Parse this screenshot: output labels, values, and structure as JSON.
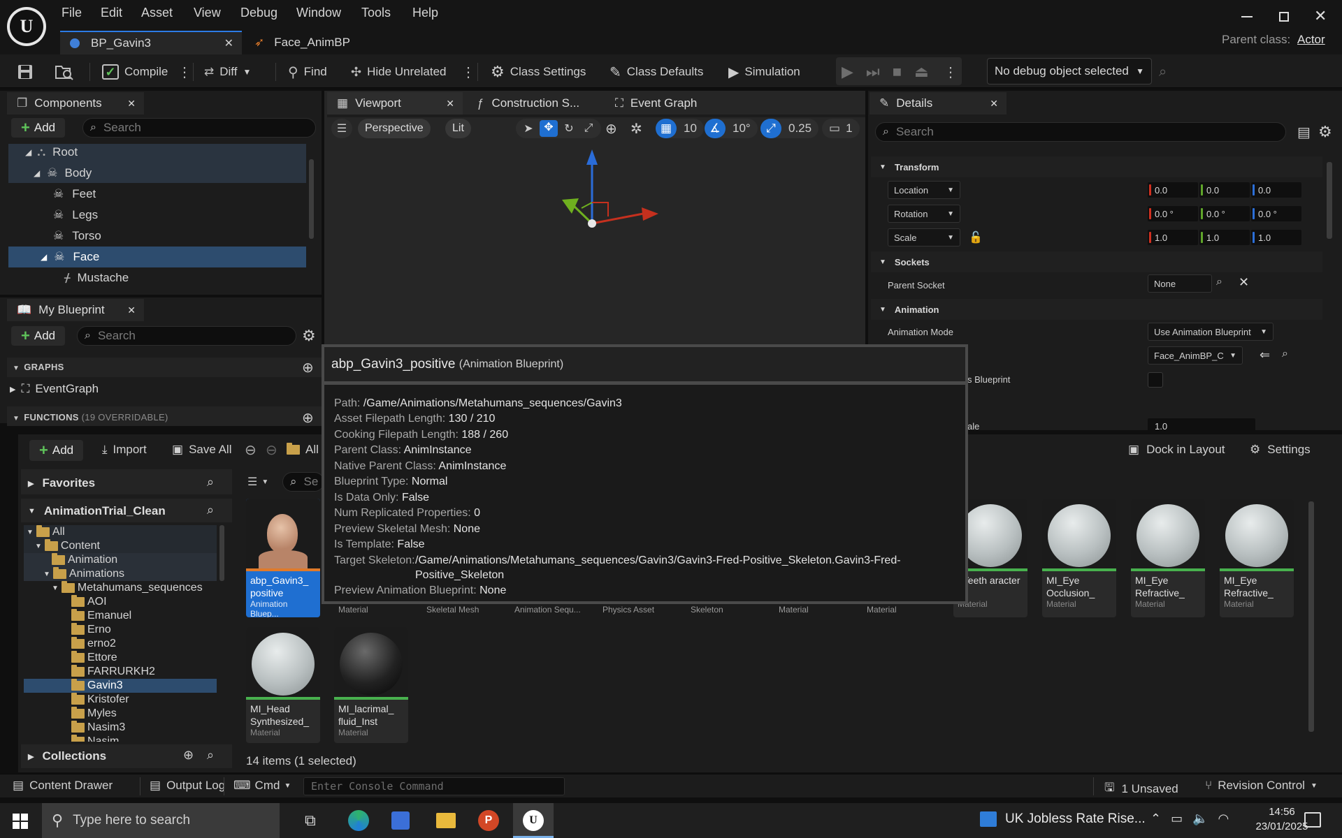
{
  "menu": [
    "File",
    "Edit",
    "Asset",
    "View",
    "Debug",
    "Window",
    "Tools",
    "Help"
  ],
  "doc_tabs": [
    {
      "label": "BP_Gavin3",
      "active": true
    },
    {
      "label": "Face_AnimBP",
      "active": false
    }
  ],
  "parent_class": {
    "label": "Parent class:",
    "value": "Actor"
  },
  "toolbar": {
    "compile": "Compile",
    "diff": "Diff",
    "find": "Find",
    "hide_unrelated": "Hide Unrelated",
    "class_settings": "Class Settings",
    "class_defaults": "Class Defaults",
    "simulation": "Simulation",
    "debug_object": "No debug object selected"
  },
  "components": {
    "tab": "Components",
    "add": "Add",
    "search_placeholder": "Search",
    "tree": [
      "Root",
      "Body",
      "Feet",
      "Legs",
      "Torso",
      "Face",
      "Mustache"
    ]
  },
  "viewport": {
    "tabs": [
      "Viewport",
      "Construction S...",
      "Event Graph"
    ],
    "perspective": "Perspective",
    "lit": "Lit",
    "grid_snap": "10",
    "rot_snap": "10°",
    "scale_snap": "0.25",
    "cam_speed": "1"
  },
  "my_blueprint": {
    "tab": "My Blueprint",
    "add": "Add",
    "search_placeholder": "Search",
    "graphs_header": "GRAPHS",
    "event_graph": "EventGraph",
    "functions_header": "FUNCTIONS",
    "functions_count": "(19 OVERRIDABLE)"
  },
  "details": {
    "tab": "Details",
    "search_placeholder": "Search",
    "transform": "Transform",
    "location": {
      "label": "Location",
      "x": "0.0",
      "y": "0.0",
      "z": "0.0"
    },
    "rotation": {
      "label": "Rotation",
      "x": "0.0 °",
      "y": "0.0 °",
      "z": "0.0 °"
    },
    "scale": {
      "label": "Scale",
      "x": "1.0",
      "y": "1.0",
      "z": "1.0"
    },
    "sockets": "Sockets",
    "parent_socket": "Parent Socket",
    "parent_socket_value": "None",
    "animation": "Animation",
    "animation_mode": "Animation Mode",
    "animation_mode_value": "Use Animation Blueprint",
    "anim_class_value": "Face_AnimBP_C",
    "partial_label_1": "s Blueprint",
    "partial_label_2": "ale",
    "rate_value": "1.0"
  },
  "content_browser": {
    "add": "Add",
    "import": "Import",
    "save_all": "Save All",
    "all": "All",
    "dock": "Dock in Layout",
    "settings": "Settings",
    "favorites": "Favorites",
    "project": "AnimationTrial_Clean",
    "collections": "Collections",
    "search_placeholder": "Se",
    "folders": [
      {
        "name": "All",
        "depth": 0
      },
      {
        "name": "Content",
        "depth": 1
      },
      {
        "name": "Animation",
        "depth": 2
      },
      {
        "name": "Animations",
        "depth": 2
      },
      {
        "name": "Metahumans_sequences",
        "depth": 3
      },
      {
        "name": "AOI",
        "depth": 4
      },
      {
        "name": "Emanuel",
        "depth": 4
      },
      {
        "name": "Erno",
        "depth": 4
      },
      {
        "name": "erno2",
        "depth": 4
      },
      {
        "name": "Ettore",
        "depth": 4
      },
      {
        "name": "FARRURKH2",
        "depth": 4
      },
      {
        "name": "Gavin3",
        "depth": 4
      },
      {
        "name": "Kristofer",
        "depth": 4
      },
      {
        "name": "Myles",
        "depth": 4
      },
      {
        "name": "Nasim3",
        "depth": 4
      },
      {
        "name": "Nasim",
        "depth": 4
      }
    ],
    "selected_asset": {
      "name": "abp_Gavin3_ positive",
      "type": "Animation Bluep..."
    },
    "hidden_types": [
      "Material",
      "Skeletal Mesh",
      "Animation Sequ...",
      "Physics Asset",
      "Skeleton",
      "Material",
      "Material"
    ],
    "assets_right": [
      {
        "name": "_Teeth aracter",
        "type": "Material"
      },
      {
        "name": "MI_Eye Occlusion_",
        "type": "Material"
      },
      {
        "name": "MI_Eye Refractive_",
        "type": "Material"
      },
      {
        "name": "MI_Eye Refractive_",
        "type": "Material"
      }
    ],
    "assets_row2": [
      {
        "name": "MI_Head Synthesized_",
        "type": "Material"
      },
      {
        "name": "MI_lacrimal_ fluid_Inst",
        "type": "Material"
      }
    ],
    "item_count": "14 items (1 selected)"
  },
  "tooltip": {
    "title": "abp_Gavin3_positive",
    "title_type": "(Animation Blueprint)",
    "rows": [
      {
        "k": "Path:",
        "v": "/Game/Animations/Metahumans_sequences/Gavin3"
      },
      {
        "k": "Asset Filepath Length:",
        "v": "130 / 210"
      },
      {
        "k": "Cooking Filepath Length:",
        "v": "188 / 260"
      },
      {
        "k": "Parent Class:",
        "v": "AnimInstance"
      },
      {
        "k": "Native Parent Class:",
        "v": "AnimInstance"
      },
      {
        "k": "Blueprint Type:",
        "v": "Normal"
      },
      {
        "k": "Is Data Only:",
        "v": "False"
      },
      {
        "k": "Num Replicated Properties:",
        "v": "0"
      },
      {
        "k": "Preview Skeletal Mesh:",
        "v": "None"
      },
      {
        "k": "Is Template:",
        "v": "False"
      }
    ],
    "skeleton_key": "Target Skeleton:",
    "skeleton_v1": "/Game/Animations/Metahumans_sequences/Gavin3/Gavin3-Fred-Positive_Skeleton.Gavin3-Fred-",
    "skeleton_v2": "Positive_Skeleton",
    "preview_key": "Preview Animation Blueprint:",
    "preview_v": "None"
  },
  "status": {
    "content_drawer": "Content Drawer",
    "output_log": "Output Log",
    "cmd": "Cmd",
    "console_placeholder": "Enter Console Command",
    "unsaved": "1 Unsaved",
    "revision": "Revision Control"
  },
  "taskbar": {
    "search_placeholder": "Type here to search",
    "news": "UK Jobless Rate Rise...",
    "time": "14:56",
    "date": "23/01/2025"
  }
}
